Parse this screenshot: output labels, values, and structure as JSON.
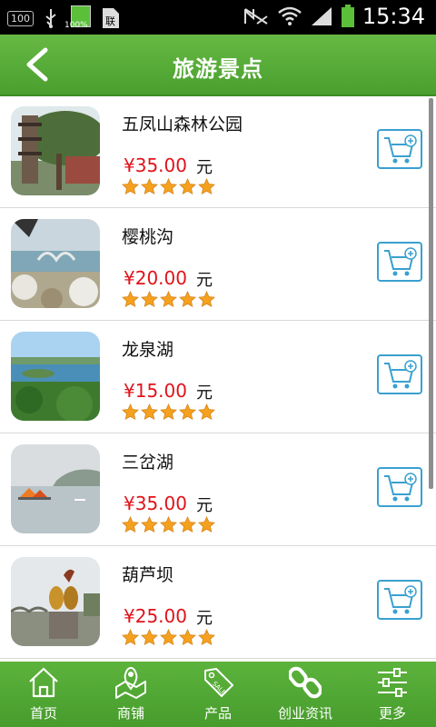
{
  "status_bar": {
    "battery_level_label": "100",
    "battery_percent": "100%",
    "time": "15:34"
  },
  "header": {
    "title": "旅游景点"
  },
  "items": [
    {
      "name": "五凤山森林公园",
      "price": "¥35.00",
      "unit": "元",
      "rating": 5
    },
    {
      "name": "樱桃沟",
      "price": "¥20.00",
      "unit": "元",
      "rating": 5
    },
    {
      "name": "龙泉湖",
      "price": "¥15.00",
      "unit": "元",
      "rating": 5
    },
    {
      "name": "三岔湖",
      "price": "¥35.00",
      "unit": "元",
      "rating": 5
    },
    {
      "name": "葫芦坝",
      "price": "¥25.00",
      "unit": "元",
      "rating": 5
    }
  ],
  "tabs": [
    {
      "label": "首页",
      "icon": "home-icon"
    },
    {
      "label": "商铺",
      "icon": "map-icon"
    },
    {
      "label": "产品",
      "icon": "sale-tag-icon"
    },
    {
      "label": "创业资讯",
      "icon": "link-icon"
    },
    {
      "label": "更多",
      "icon": "sliders-icon"
    }
  ],
  "colors": {
    "brand_green": "#4a9f2e",
    "price_red": "#e0131a",
    "cart_blue": "#3aa0d0",
    "star_orange": "#f5a01f"
  }
}
